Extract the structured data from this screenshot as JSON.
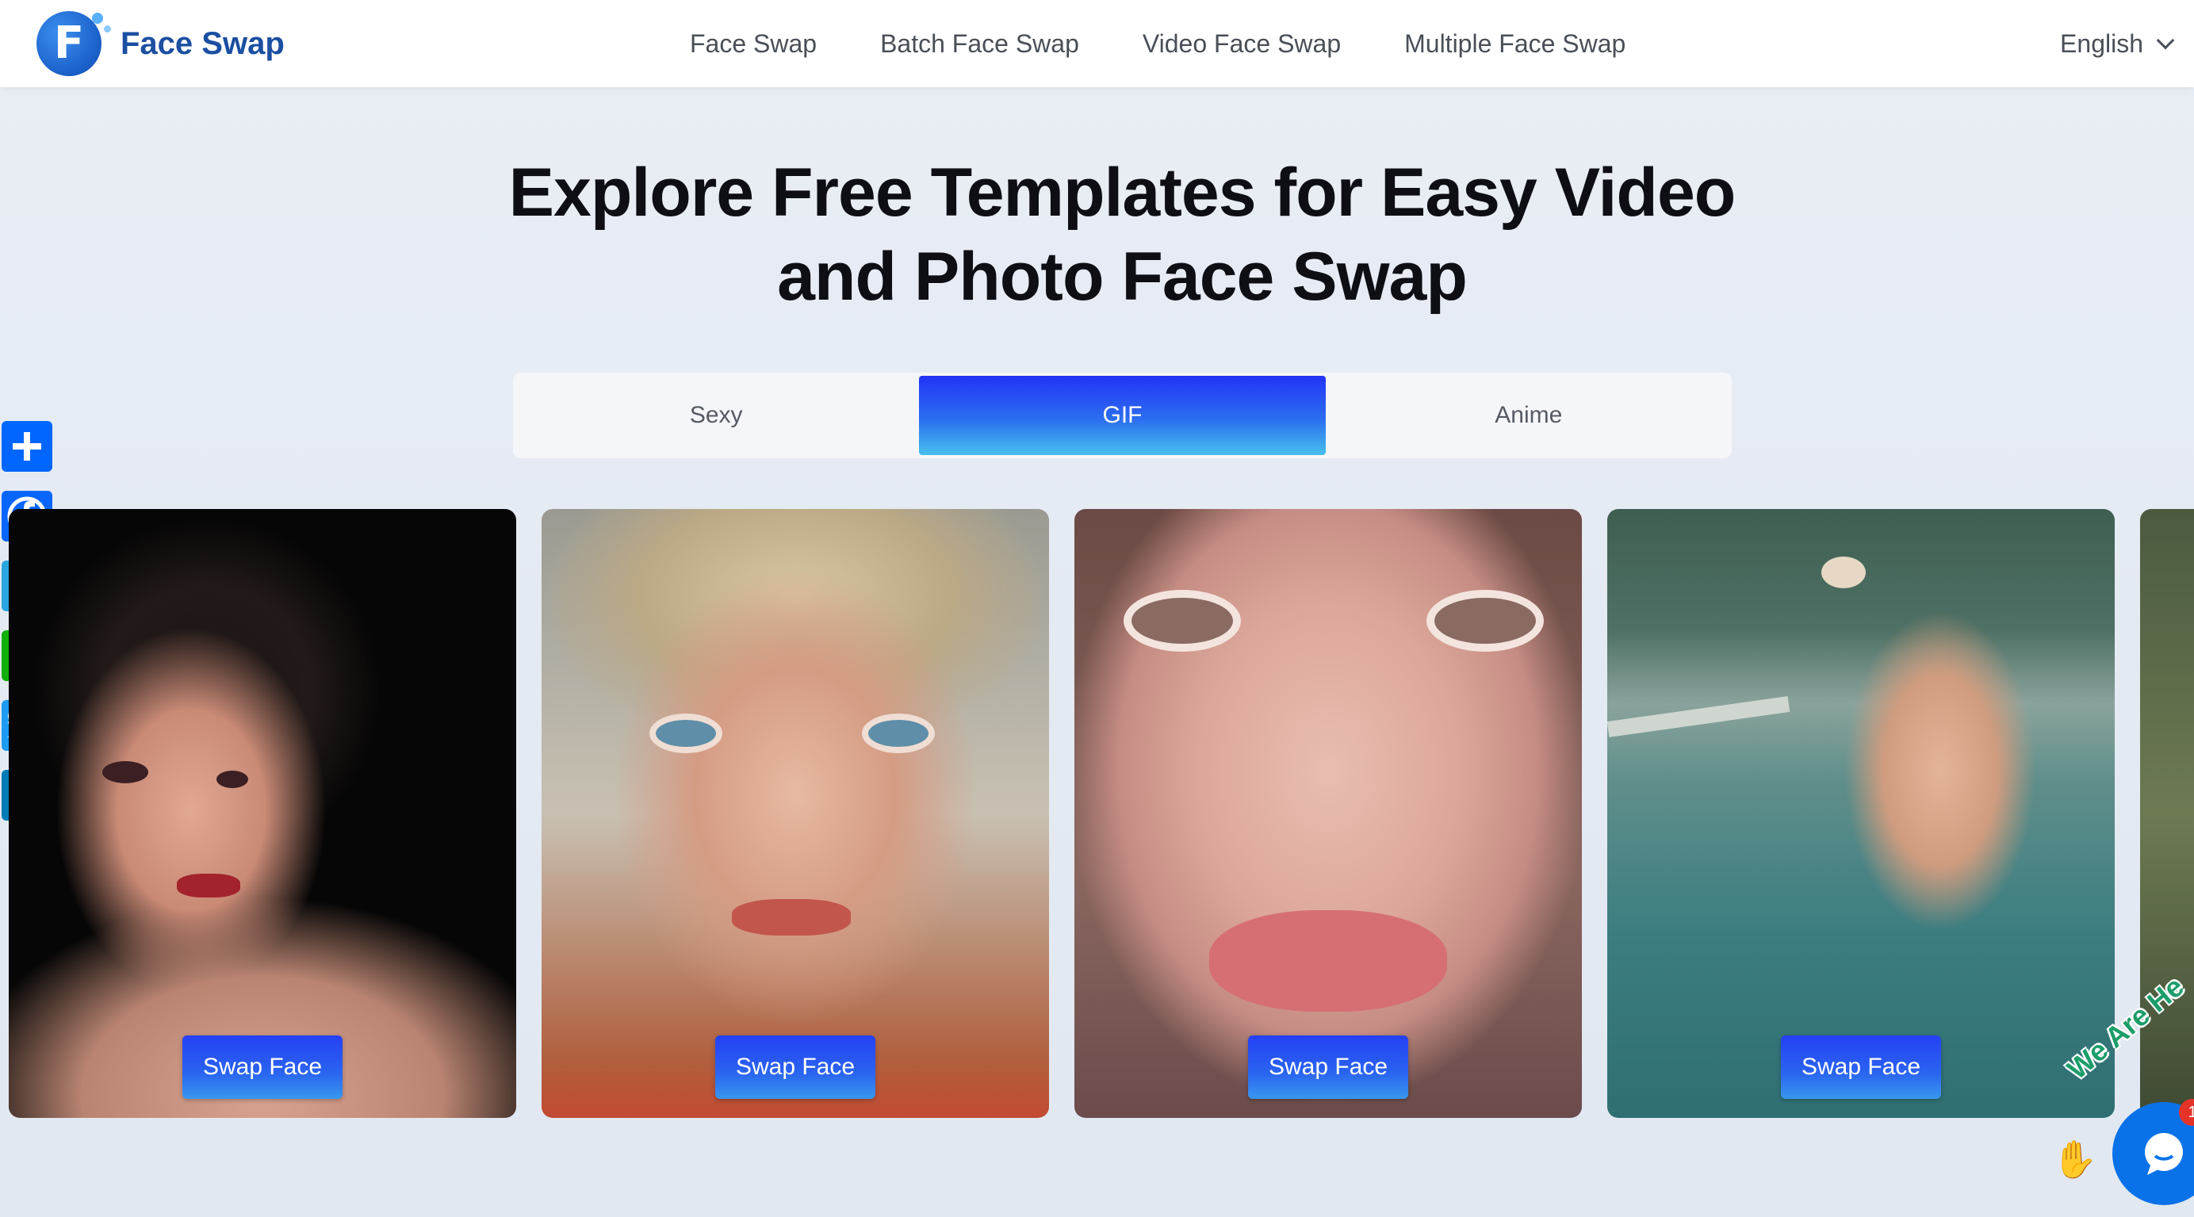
{
  "header": {
    "brand": "Face Swap",
    "logo_letter": "F",
    "nav": [
      {
        "label": "Face Swap"
      },
      {
        "label": "Batch Face Swap"
      },
      {
        "label": "Video Face Swap"
      },
      {
        "label": "Multiple Face Swap"
      }
    ],
    "language": "English"
  },
  "hero": {
    "title_line1": "Explore Free Templates for Easy Video",
    "title_line2": "and Photo Face Swap"
  },
  "tabs": [
    {
      "label": "Sexy",
      "active": false
    },
    {
      "label": "GIF",
      "active": true
    },
    {
      "label": "Anime",
      "active": false
    }
  ],
  "share_bar": [
    {
      "icon": "plus-icon",
      "color": "#0166ff"
    },
    {
      "icon": "facebook-icon",
      "color": "#0866ff"
    },
    {
      "icon": "telegram-icon",
      "color": "#2aa5df"
    },
    {
      "icon": "whatsapp-icon",
      "color": "#12af0a"
    },
    {
      "icon": "twitter-icon",
      "color": "#1d9bf0"
    },
    {
      "icon": "linkedin-icon",
      "color": "#007bb5"
    }
  ],
  "cards": [
    {
      "button_label": "Swap Face"
    },
    {
      "button_label": "Swap Face"
    },
    {
      "button_label": "Swap Face"
    },
    {
      "button_label": "Swap Face"
    }
  ],
  "chat_widget": {
    "banner": "We Are He",
    "badge": "1"
  },
  "colors": {
    "brand": "#1b4fa1",
    "accent_gradient_start": "#2333f6",
    "accent_gradient_end": "#47c0ec"
  }
}
